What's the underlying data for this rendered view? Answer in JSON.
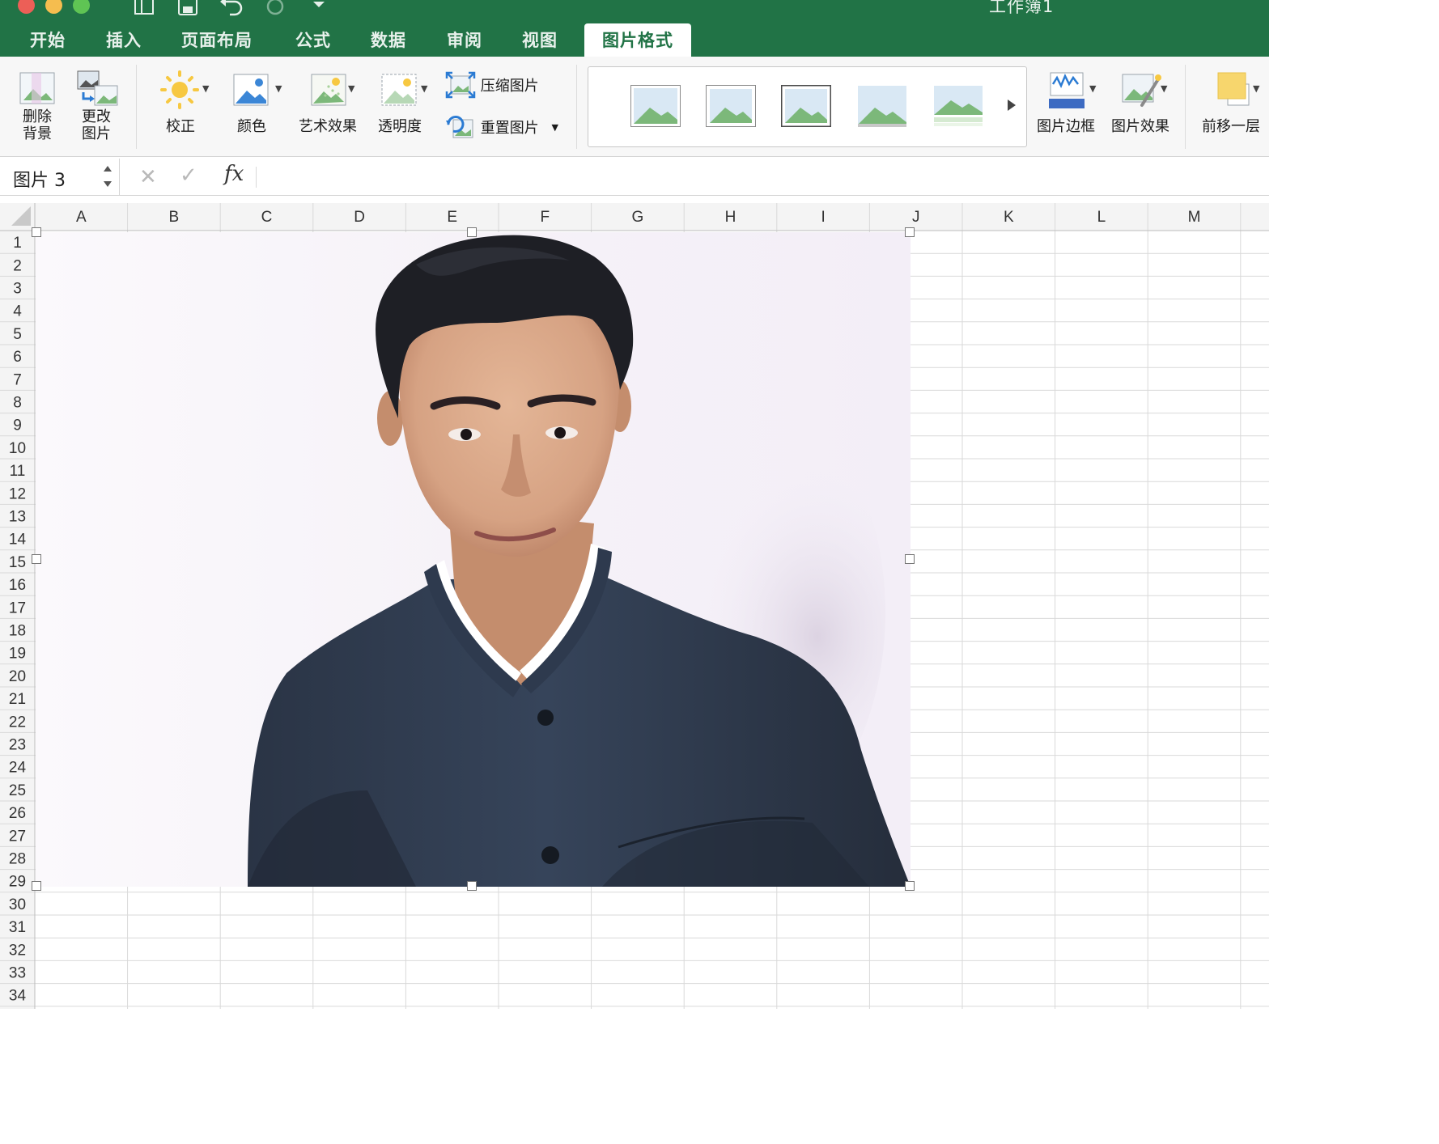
{
  "window": {
    "title": "工作簿1",
    "traffic_lights": {
      "close": "#ec5f57",
      "minimize": "#f5bd4f",
      "zoom": "#5fc454"
    }
  },
  "quick_access": [
    "sidebar-icon",
    "save-icon",
    "undo-icon",
    "redo-icon",
    "customize-icon"
  ],
  "tabs": [
    {
      "label": "开始",
      "active": false
    },
    {
      "label": "插入",
      "active": false
    },
    {
      "label": "页面布局",
      "active": false
    },
    {
      "label": "公式",
      "active": false
    },
    {
      "label": "数据",
      "active": false
    },
    {
      "label": "审阅",
      "active": false
    },
    {
      "label": "视图",
      "active": false
    },
    {
      "label": "图片格式",
      "active": true
    }
  ],
  "ribbon": {
    "remove_background": {
      "line1": "删除",
      "line2": "背景"
    },
    "change_picture": {
      "line1": "更改",
      "line2": "图片"
    },
    "corrections": "校正",
    "color": "颜色",
    "artistic_effects": "艺术效果",
    "transparency": "透明度",
    "compress_pictures": "压缩图片",
    "reset_picture": "重置图片",
    "picture_border": "图片边框",
    "picture_effects": "图片效果",
    "bring_forward": "前移一层"
  },
  "formula_bar": {
    "name_box": "图片 3",
    "fx": "fx",
    "formula": ""
  },
  "grid": {
    "columns": [
      "A",
      "B",
      "C",
      "D",
      "E",
      "F",
      "G",
      "H",
      "I",
      "J",
      "K",
      "L",
      "M"
    ],
    "rows": [
      "1",
      "2",
      "3",
      "4",
      "5",
      "6",
      "7",
      "8",
      "9",
      "10",
      "11",
      "12",
      "13",
      "14",
      "15",
      "16",
      "17",
      "18",
      "19",
      "20",
      "21",
      "22",
      "23",
      "24",
      "25",
      "26",
      "27",
      "28",
      "29",
      "30",
      "31",
      "32",
      "33",
      "34"
    ]
  },
  "colors": {
    "excel_green": "#217346",
    "gridline": "#d9d9d9",
    "jacket": "#2f3a4c",
    "skin": "#d8a687",
    "hair": "#1c1d22",
    "photo_background": "#f7f3f9"
  }
}
